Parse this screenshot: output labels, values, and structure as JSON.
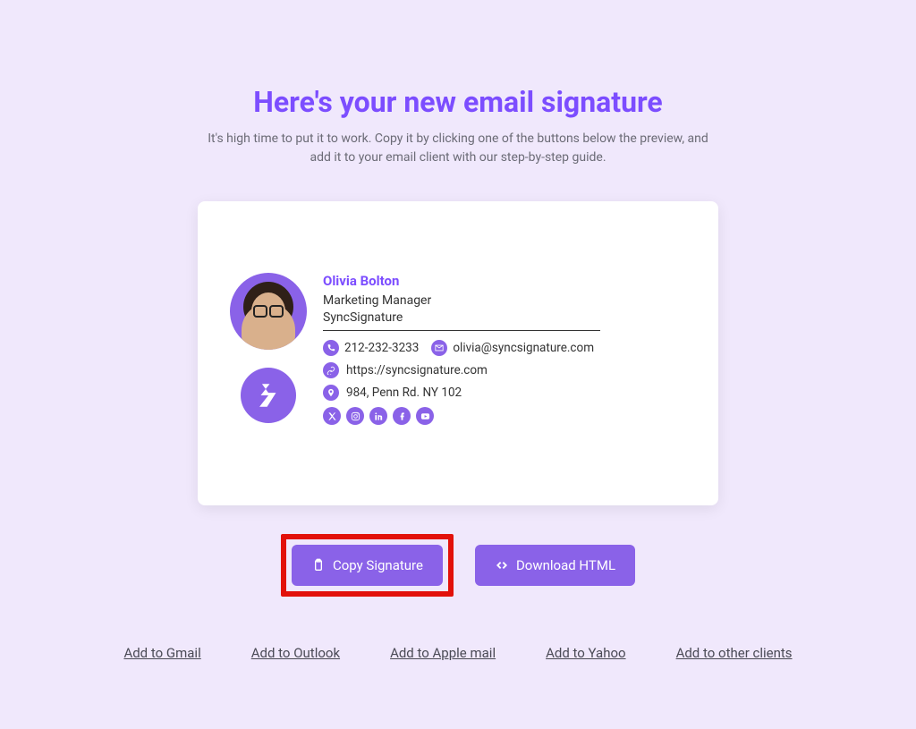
{
  "header": {
    "title": "Here's your new email signature",
    "subtitle": "It's high time to put it to work. Copy it by clicking one of the buttons below the preview, and add it to your email client with our step-by-step guide."
  },
  "signature": {
    "name": "Olivia Bolton",
    "role": "Marketing Manager",
    "company": "SyncSignature",
    "phone": "212-232-3233",
    "email": "olivia@syncsignature.com",
    "website": "https://syncsignature.com",
    "address": "984, Penn Rd. NY 102",
    "socials": [
      "x",
      "instagram",
      "linkedin",
      "facebook",
      "youtube"
    ]
  },
  "actions": {
    "copy": "Copy Signature",
    "download": "Download HTML"
  },
  "links": {
    "gmail": "Add to Gmail",
    "outlook": "Add to Outlook",
    "apple": "Add to Apple mail",
    "yahoo": "Add to Yahoo",
    "other": "Add to other clients"
  },
  "colors": {
    "accent": "#8a62e8",
    "highlight": "#e2110a"
  }
}
